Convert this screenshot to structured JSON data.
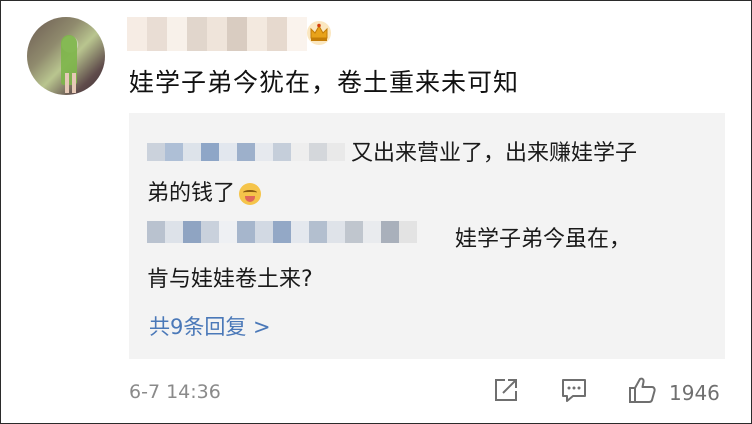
{
  "comment": {
    "text": "娃学子弟今犹在，卷土重来未可知",
    "timestamp": "6-7 14:36",
    "like_count": "1946"
  },
  "replies": [
    {
      "text_line1": "又出来营业了，出来赚娃学子",
      "text_line2": "弟的钱了",
      "emoji": "face-savoring-emoji"
    },
    {
      "text_line1": "娃学子弟今虽在，",
      "text_line2": "肯与娃娃卷土来?"
    }
  ],
  "more_replies": "共9条回复 >",
  "colors": {
    "link": "#4a78b8",
    "reply_bg": "#f3f3f3",
    "muted": "#8a8a8a",
    "crown": "#e8a21a"
  }
}
